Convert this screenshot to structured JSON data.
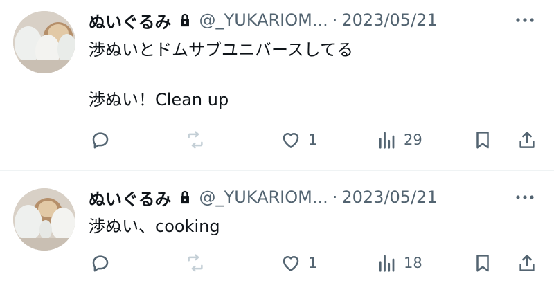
{
  "tweets": [
    {
      "name": "ぬいぐるみ",
      "handle": "@_YUKARIOM...",
      "separator": "·",
      "date": "2023/05/21",
      "text": "渉ぬいとドムサブユニバースしてる\n\n渉ぬい！Clean up",
      "likes": "1",
      "views": "29"
    },
    {
      "name": "ぬいぐるみ",
      "handle": "@_YUKARIOM...",
      "separator": "·",
      "date": "2023/05/21",
      "text": "渉ぬい、cooking",
      "likes": "1",
      "views": "18"
    }
  ],
  "colors": {
    "text": "#0f1419",
    "secondary": "#536471",
    "divider": "#eff3f4",
    "retweet_disabled": "#c4cfd6"
  },
  "icons": [
    "lock-icon",
    "more-icon",
    "reply-icon",
    "retweet-icon",
    "like-icon",
    "views-icon",
    "bookmark-icon",
    "share-icon"
  ]
}
